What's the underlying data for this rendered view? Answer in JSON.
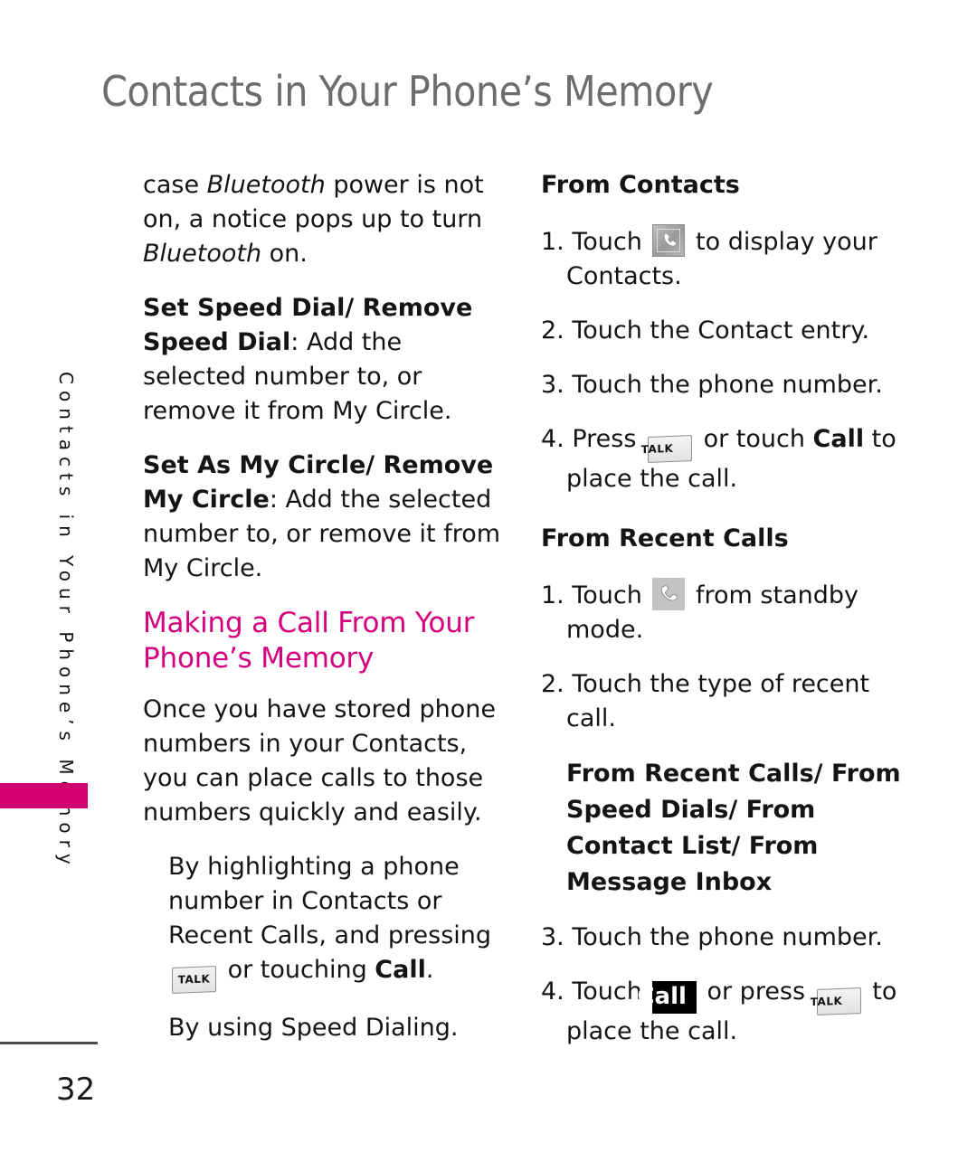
{
  "page": {
    "title": "Contacts in Your Phone’s Memory",
    "number": "32",
    "side_tab_label": "Contacts in Your Phone’s Memory",
    "accent_color": "#d6007f",
    "tab_block_color": "#d1006e",
    "title_color": "#6d6d6d"
  },
  "left_column": {
    "para_bluetooth": {
      "before": "case ",
      "italic_1": "Bluetooth",
      "middle": " power is not on, a notice pops up to turn ",
      "italic_2": "Bluetooth",
      "after": " on."
    },
    "speed_dial": {
      "lead": "Set Speed Dial/ Remove Speed Dial",
      "body": ": Add the selected number to, or remove it from My Circle."
    },
    "my_circle": {
      "lead": "Set As My Circle/ Remove My Circle",
      "body": ": Add the selected number to, or remove it from My Circle."
    },
    "section_heading": "Making a Call From Your Phone’s Memory",
    "intro": "Once you have stored phone numbers in your Contacts, you can place calls to those numbers quickly and easily.",
    "bullet_1": {
      "before": "By highlighting a phone number in Contacts or Recent Calls, and pressing ",
      "key": "TALK",
      "middle": " or touching ",
      "bold": "Call",
      "after": "."
    },
    "bullet_2": "By using Speed Dialing."
  },
  "right_column": {
    "from_contacts_heading": "From Contacts",
    "from_contacts_steps": {
      "step1": {
        "number": "1.",
        "before": " Touch ",
        "icon": "contacts-phone-icon",
        "after": " to display your Contacts."
      },
      "step2": "2. Touch the Contact entry.",
      "step3": "3. Touch the phone number.",
      "step4": {
        "number": "4.",
        "before": " Press ",
        "key": "TALK",
        "middle": " or touch ",
        "bold": "Call",
        "after": " to place the call."
      }
    },
    "from_recent_heading": "From Recent Calls",
    "from_recent_steps": {
      "step1": {
        "number": "1.",
        "before": " Touch ",
        "icon": "recent-calls-handset-icon",
        "after": " from standby mode."
      },
      "step2": "2. Touch the type of recent call.",
      "sub_heading": "From Recent Calls/ From Speed Dials/ From Contact List/ From Message Inbox",
      "step3": "3. Touch the phone number.",
      "step4": {
        "number": "4.",
        "before": " Touch ",
        "call_label": "Call",
        "middle": " or press ",
        "key": "TALK",
        "after": " to place the call."
      }
    }
  }
}
